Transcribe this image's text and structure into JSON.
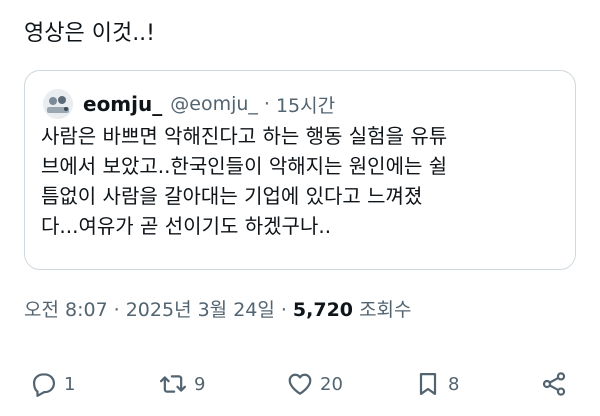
{
  "tweet": {
    "text": "영상은 이것..!"
  },
  "quote": {
    "display_name": "eomju_",
    "handle": "@eomju_",
    "dot": "·",
    "time": "15시간",
    "avatar_icon": "avatar-image",
    "body": "사람은 바쁘면 악해진다고 하는 행동 실험을 유튜\n브에서 보았고..한국인들이 악해지는 원인에는 쉴\n틈없이 사람을 갈아대는 기업에 있다고 느껴졌\n다...여유가 곧 선이기도 하겠구나.."
  },
  "meta": {
    "time": "오전 8:07",
    "sep1": "·",
    "date": "2025년 3월 24일",
    "sep2": "·",
    "views_count": "5,720",
    "views_label": "조회수"
  },
  "actions": {
    "reply": {
      "icon": "reply-icon",
      "count": "1"
    },
    "retweet": {
      "icon": "retweet-icon",
      "count": "9"
    },
    "like": {
      "icon": "heart-icon",
      "count": "20"
    },
    "bookmark": {
      "icon": "bookmark-icon",
      "count": "8"
    },
    "share": {
      "icon": "share-icon"
    }
  },
  "colors": {
    "text": "#0f1419",
    "secondary": "#536471",
    "border": "#cfd9de"
  }
}
